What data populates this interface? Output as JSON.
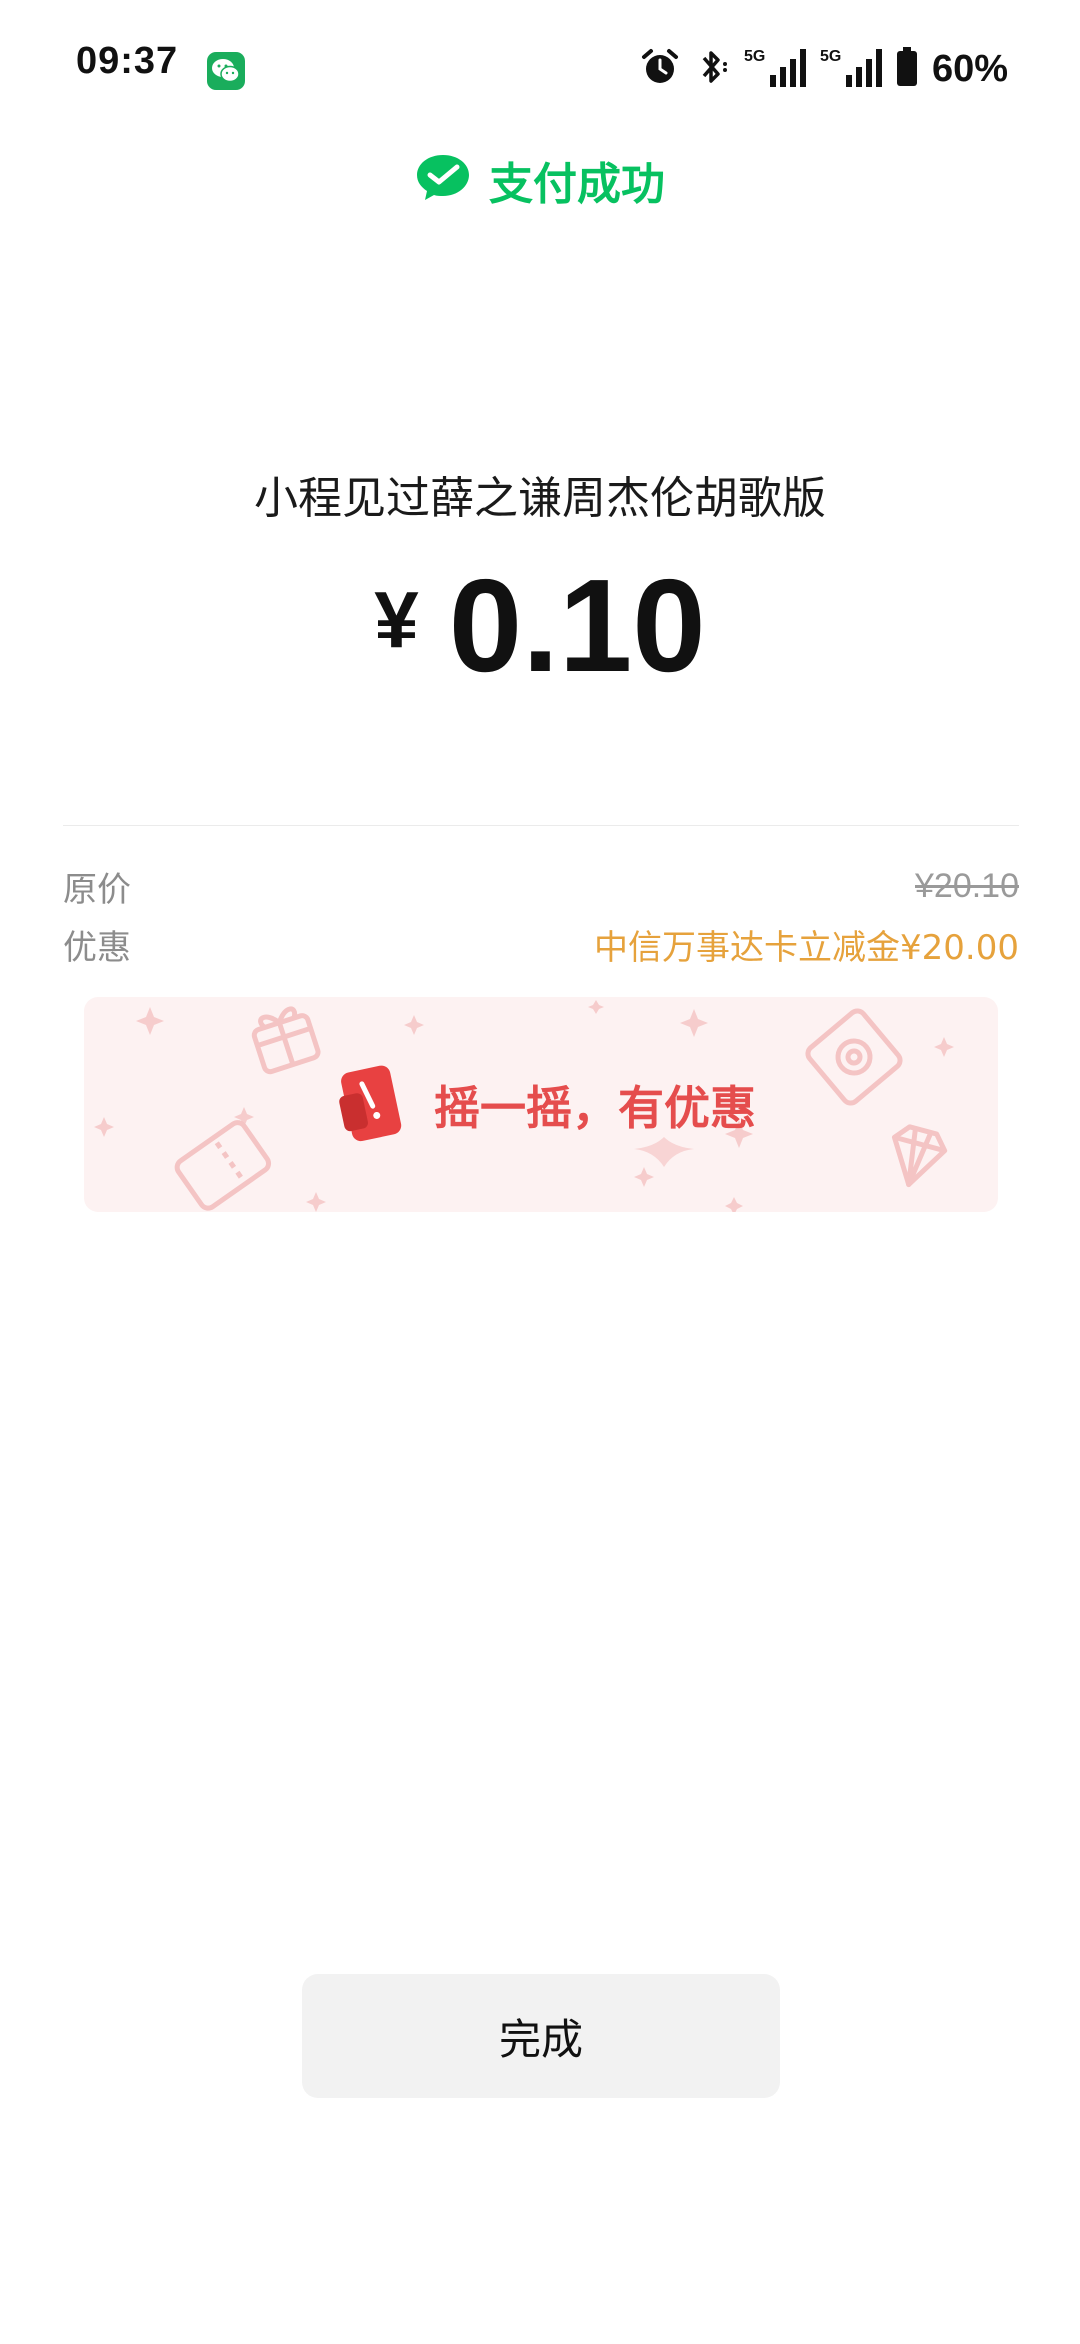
{
  "status_bar": {
    "time": "09:37",
    "battery": "60%",
    "network_1": "5G",
    "network_2": "5G",
    "icons": [
      "wechat-notification-icon",
      "alarm-icon",
      "bluetooth-icon",
      "signal-5g-icon",
      "signal-5g-icon",
      "battery-icon"
    ]
  },
  "header": {
    "title": "支付成功",
    "icon": "wechat-pay-check-icon",
    "accent_color": "#07c160"
  },
  "payment": {
    "merchant": "小程见过薛之谦周杰伦胡歌版",
    "currency_symbol": "¥",
    "amount": "0.10"
  },
  "details": {
    "original_label": "原价",
    "original_value": "¥20.10",
    "discount_label": "优惠",
    "discount_value": "中信万事达卡立减金¥20.00",
    "discount_color": "#e6a23c"
  },
  "banner": {
    "text": "摇一摇，有优惠",
    "icon": "shake-phone-icon",
    "text_color": "#e54d4d"
  },
  "actions": {
    "done_label": "完成"
  }
}
